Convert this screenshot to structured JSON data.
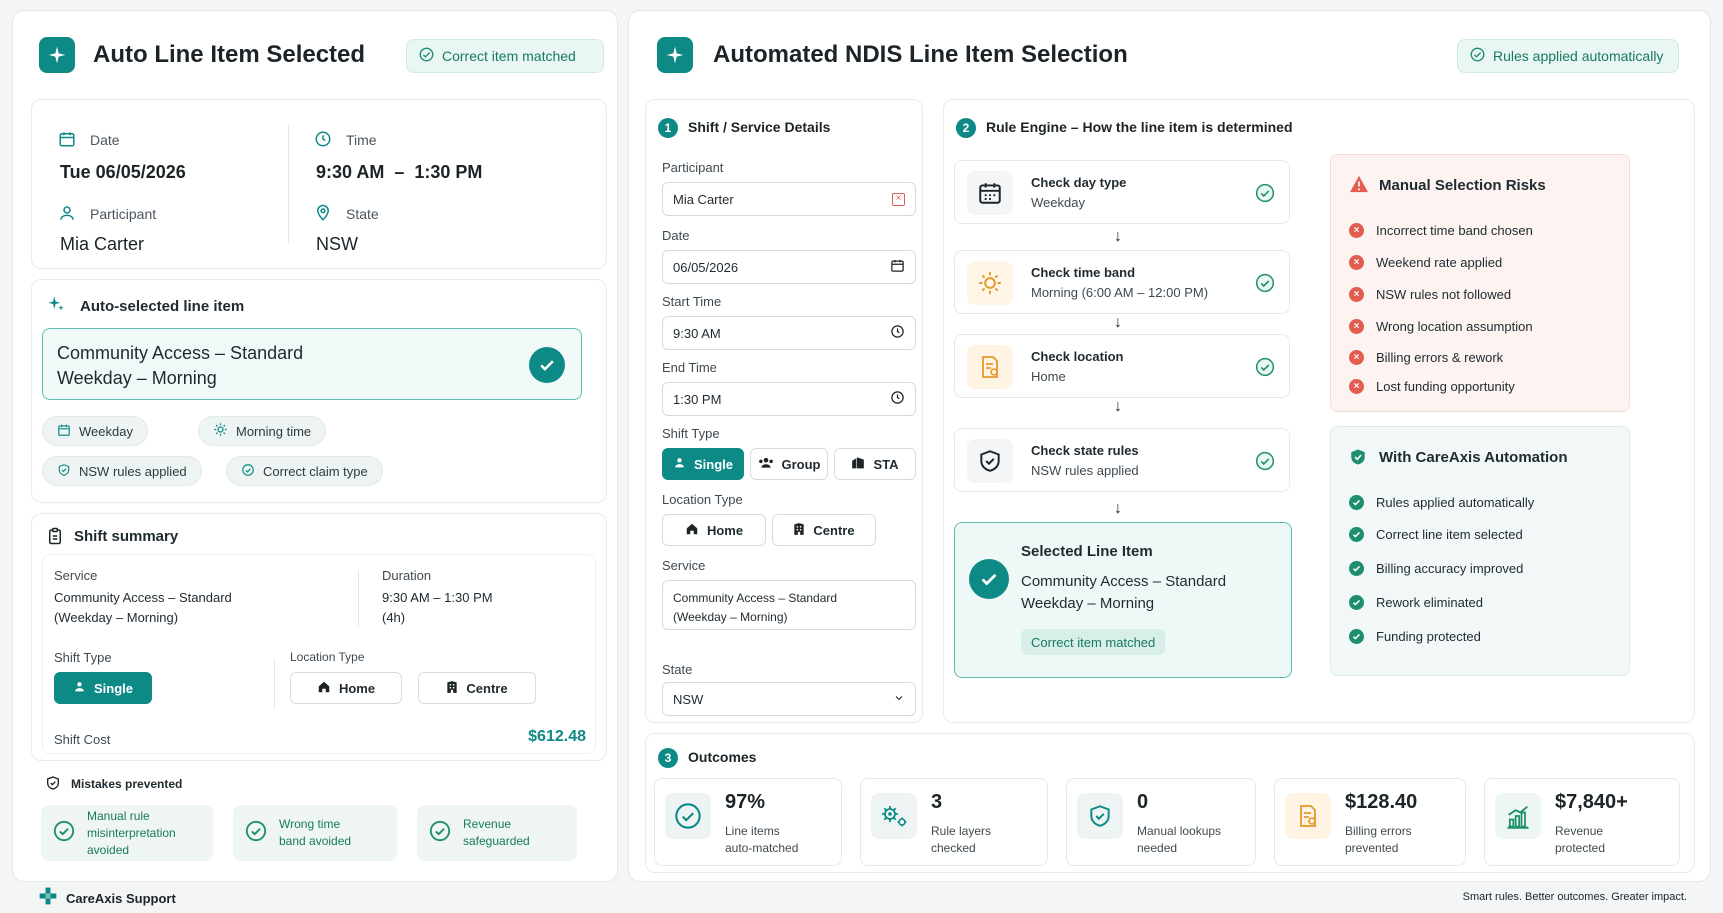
{
  "left": {
    "title": "Auto Line Item Selected",
    "badge": "Correct item matched",
    "date_label": "Date",
    "date_value": "Tue 06/05/2026",
    "time_label": "Time",
    "time_value": "9:30 AM  –  1:30 PM",
    "participant_label": "Participant",
    "participant_value": "Mia Carter",
    "state_label": "State",
    "state_value": "NSW",
    "auto_title": "Auto-selected line item",
    "item_line1": "Community Access – Standard",
    "item_line2": "Weekday – Morning",
    "chips": [
      "Weekday",
      "Morning time",
      "NSW rules applied",
      "Correct claim type"
    ],
    "summary_title": "Shift summary",
    "service_label": "Service",
    "service_line1": "Community Access – Standard",
    "service_line2": "(Weekday – Morning)",
    "duration_label": "Duration",
    "duration_line1": "9:30 AM – 1:30 PM",
    "duration_line2": "(4h)",
    "shift_type_label": "Shift Type",
    "shift_type_value": "Single",
    "location_type_label": "Location Type",
    "loc_home": "Home",
    "loc_centre": "Centre",
    "cost_label": "Shift Cost",
    "cost_value": "$612.48",
    "mistakes_title": "Mistakes prevented",
    "mistakes": [
      {
        "l1": "Manual rule",
        "l2": "misinterpretation",
        "l3": "avoided"
      },
      {
        "l1": "Wrong time",
        "l2": "band avoided",
        "l3": ""
      },
      {
        "l1": "Revenue",
        "l2": "safeguarded",
        "l3": ""
      }
    ]
  },
  "right": {
    "title": "Automated NDIS Line Item Selection",
    "badge": "Rules applied automatically",
    "s1_num": "1",
    "s1_title": "Shift / Service Details",
    "participant_label": "Participant",
    "participant_value": "Mia Carter",
    "date_label": "Date",
    "date_value": "06/05/2026",
    "start_label": "Start Time",
    "start_value": "9:30 AM",
    "end_label": "End Time",
    "end_value": "1:30 PM",
    "shift_type_label": "Shift Type",
    "shift_types": [
      "Single",
      "Group",
      "STA"
    ],
    "location_label": "Location Type",
    "locations": [
      "Home",
      "Centre"
    ],
    "service_label": "Service",
    "service_line1": "Community Access – Standard",
    "service_line2": "(Weekday – Morning)",
    "state_label": "State",
    "state_value": "NSW",
    "s2_num": "2",
    "s2_title": "Rule Engine – How the line item is determined",
    "rules": [
      {
        "title": "Check day type",
        "sub": "Weekday"
      },
      {
        "title": "Check time band",
        "sub": "Morning (6:00 AM – 12:00 PM)"
      },
      {
        "title": "Check location",
        "sub": "Home"
      },
      {
        "title": "Check state rules",
        "sub": "NSW rules applied"
      }
    ],
    "selected_title": "Selected Line Item",
    "selected_line1": "Community Access – Standard",
    "selected_line2": "Weekday – Morning",
    "selected_badge": "Correct item matched",
    "risks_title": "Manual Selection Risks",
    "risks": [
      "Incorrect time band chosen",
      "Weekend rate applied",
      "NSW rules not followed",
      "Wrong location assumption",
      "Billing errors & rework",
      "Lost funding opportunity"
    ],
    "auto_title": "With CareAxis Automation",
    "benefits": [
      "Rules applied automatically",
      "Correct line item selected",
      "Billing accuracy improved",
      "Rework eliminated",
      "Funding protected"
    ],
    "s3_num": "3",
    "s3_title": "Outcomes",
    "outcomes": [
      {
        "value": "97%",
        "l1": "Line items",
        "l2": "auto-matched"
      },
      {
        "value": "3",
        "l1": "Rule layers",
        "l2": "checked"
      },
      {
        "value": "0",
        "l1": "Manual lookups",
        "l2": "needed"
      },
      {
        "value": "$128.40",
        "l1": "Billing errors",
        "l2": "prevented"
      },
      {
        "value": "$7,840+",
        "l1": "Revenue",
        "l2": "protected"
      }
    ]
  },
  "footer": {
    "brand": "CareAxis Support",
    "tagline": "Smart rules. Better outcomes. Greater impact."
  },
  "colors": {
    "accent": "#0e8a86",
    "success": "#1d8f6e",
    "danger": "#e25c4f"
  }
}
